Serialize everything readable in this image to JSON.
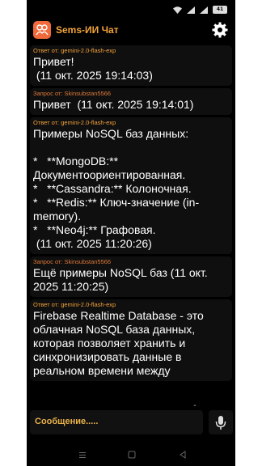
{
  "status_bar": {
    "battery": "41"
  },
  "app": {
    "title": "Sems-ИИ Чат"
  },
  "messages": [
    {
      "sender": "Ответ от: gemini-2.0-flash-exp",
      "role": "bot",
      "text": "Привет!\n (11 окт. 2025 19:14:03)"
    },
    {
      "sender": "Запрос от: Skinsubstan5566",
      "role": "user",
      "text": "Привет  (11 окт. 2025 19:14:01)"
    },
    {
      "sender": "Ответ от: gemini-2.0-flash-exp",
      "role": "bot",
      "text": "Примеры NoSQL баз данных:\n\n*   **MongoDB:** Документоориентированная.\n*   **Cassandra:** Колоночная.\n*   **Redis:** Ключ-значение (in-memory).\n*   **Neo4j:** Графовая.\n (11 окт. 2025 11:20:26)"
    },
    {
      "sender": "Запрос от: Skinsubstan5566",
      "role": "user",
      "text": "Ещё примеры NoSQL баз (11 окт. 2025 11:20:25)"
    },
    {
      "sender": "Ответ от: gemini-2.0-flash-exp",
      "role": "bot",
      "text": "Firebase Realtime Database - это облачная NoSQL база данных, которая позволяет хранить и синхронизировать данные в реальном времени между"
    }
  ],
  "input": {
    "placeholder": "Сообщение....."
  },
  "icons": {
    "settings": "gear-icon",
    "mic": "microphone-icon",
    "logo": "app-logo-icon",
    "nav_menu": "recents-icon",
    "nav_home": "home-icon",
    "nav_back": "back-icon"
  },
  "colors": {
    "accent": "#f3a33a",
    "background": "#000000",
    "bubble": "#0f0f0f",
    "logo": "#f06a3c"
  }
}
